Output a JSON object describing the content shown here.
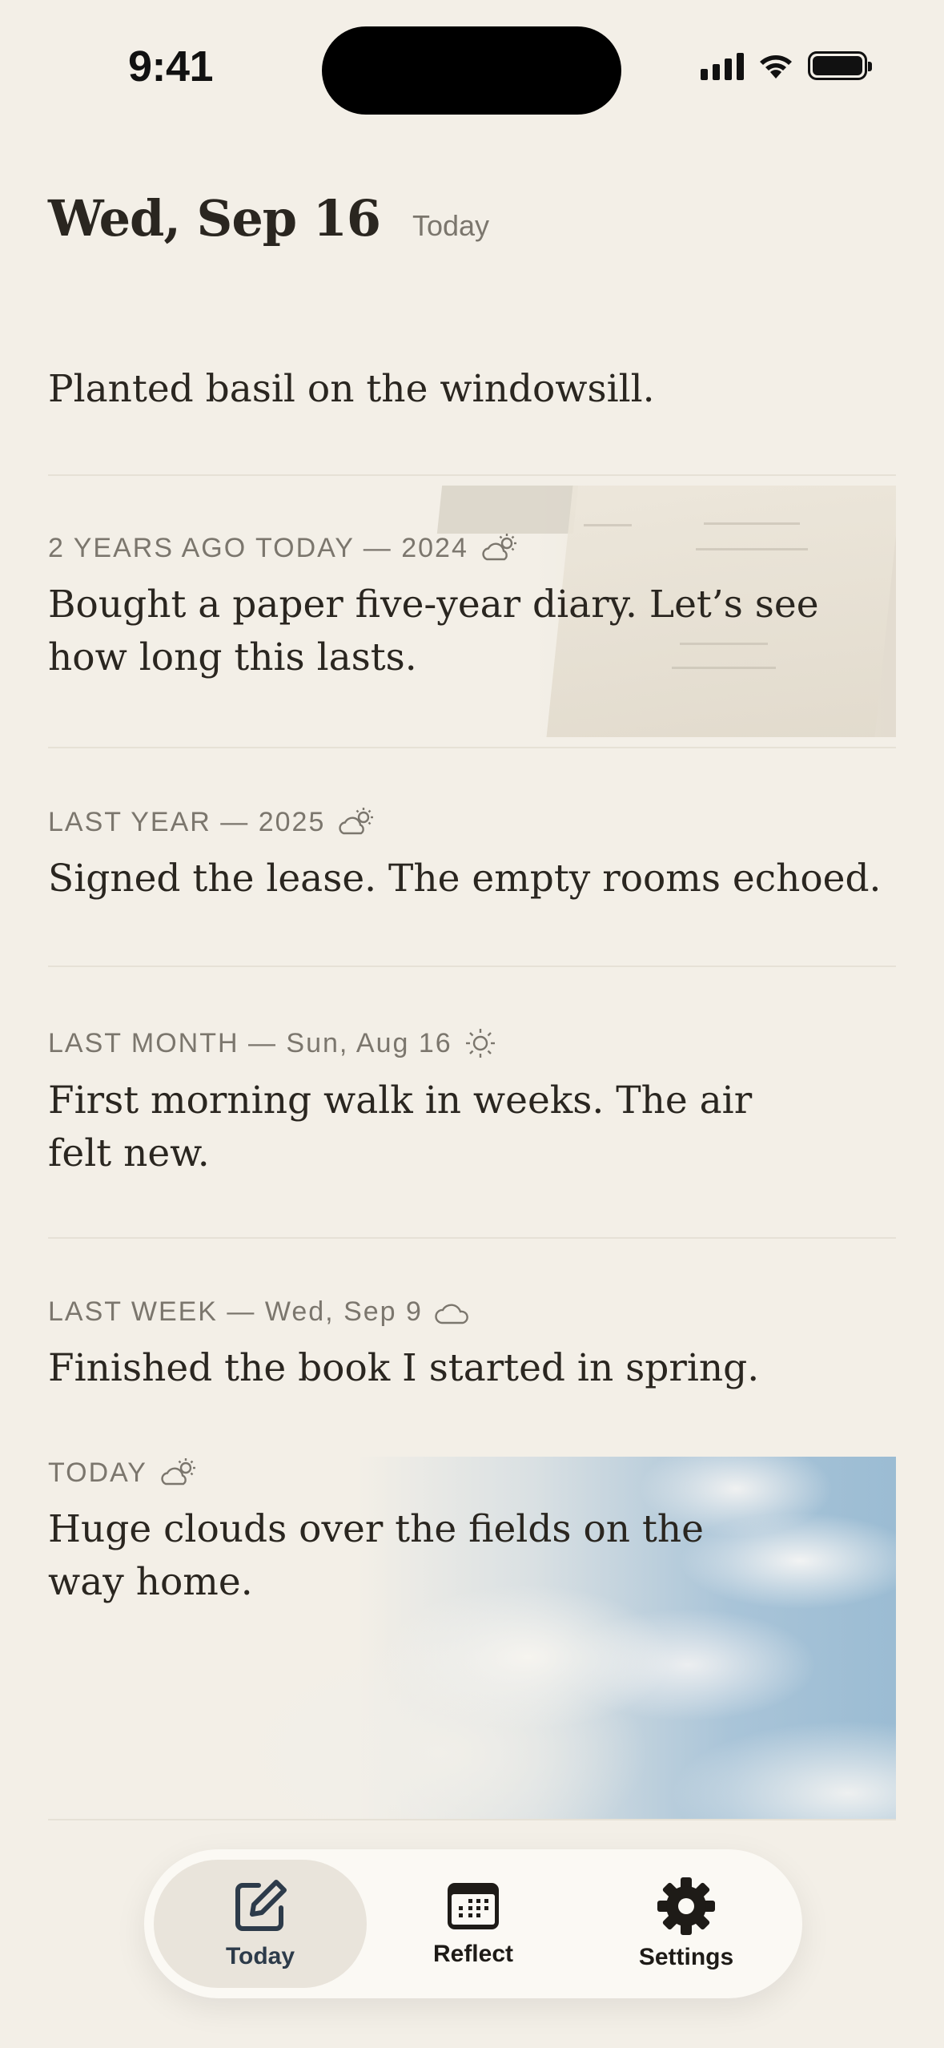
{
  "status_bar": {
    "time": "9:41"
  },
  "header": {
    "title": "Wed, Sep 16",
    "tag": "Today"
  },
  "compose": {
    "text": "Planted basil on the windowsill."
  },
  "entries": [
    {
      "meta": "2 YEARS AGO TODAY — 2024",
      "weather_icon": "partly-cloudy-icon",
      "text": "Bought a paper five-year diary. Let’s see how long this lasts.",
      "photo": "diary-photo"
    },
    {
      "meta": "LAST YEAR — 2025",
      "weather_icon": "partly-cloudy-icon",
      "text": "Signed the lease. The empty rooms echoed."
    },
    {
      "meta": "LAST MONTH — Sun, Aug 16",
      "weather_icon": "sun-icon",
      "text": "First morning walk in weeks. The air felt new."
    },
    {
      "meta": "LAST WEEK — Wed, Sep 9",
      "weather_icon": "cloud-icon",
      "text": "Finished the book I started in spring."
    },
    {
      "meta": "TODAY",
      "weather_icon": "partly-cloudy-icon",
      "text": "Huge clouds over the fields on the way home.",
      "photo": "sky-photo"
    }
  ],
  "tab_bar": {
    "tabs": [
      {
        "label": "Today",
        "icon": "compose-icon",
        "active": true
      },
      {
        "label": "Reflect",
        "icon": "calendar-icon",
        "active": false
      },
      {
        "label": "Settings",
        "icon": "gear-icon",
        "active": false
      }
    ]
  },
  "colors": {
    "background": "#f3efe7",
    "text": "#2a2620",
    "muted": "#7b766d",
    "accent": "#2d3b4a"
  }
}
